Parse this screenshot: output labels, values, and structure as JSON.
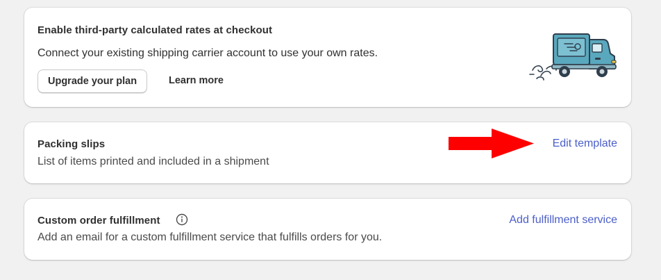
{
  "rates_card": {
    "title": "Enable third-party calculated rates at checkout",
    "description": "Connect your existing shipping carrier account to use your own rates.",
    "upgrade_button": "Upgrade your plan",
    "learn_more": "Learn more",
    "illustration_icon": "delivery-truck-icon"
  },
  "packing_card": {
    "title": "Packing slips",
    "description": "List of items printed and included in a shipment",
    "action_link": "Edit template"
  },
  "custom_card": {
    "title": "Custom order fulfillment",
    "info_icon": "info-icon",
    "description": "Add an email for a custom fulfillment service that fulfills orders for you.",
    "action_link": "Add fulfillment service"
  },
  "annotation": {
    "arrow_color": "#ff0000",
    "icon": "red-arrow-icon"
  },
  "colors": {
    "link": "#4b5ec9",
    "background": "#f1f1f1",
    "card": "#ffffff",
    "truck_body": "#5aa8bd",
    "truck_outline": "#2f3e4c"
  }
}
